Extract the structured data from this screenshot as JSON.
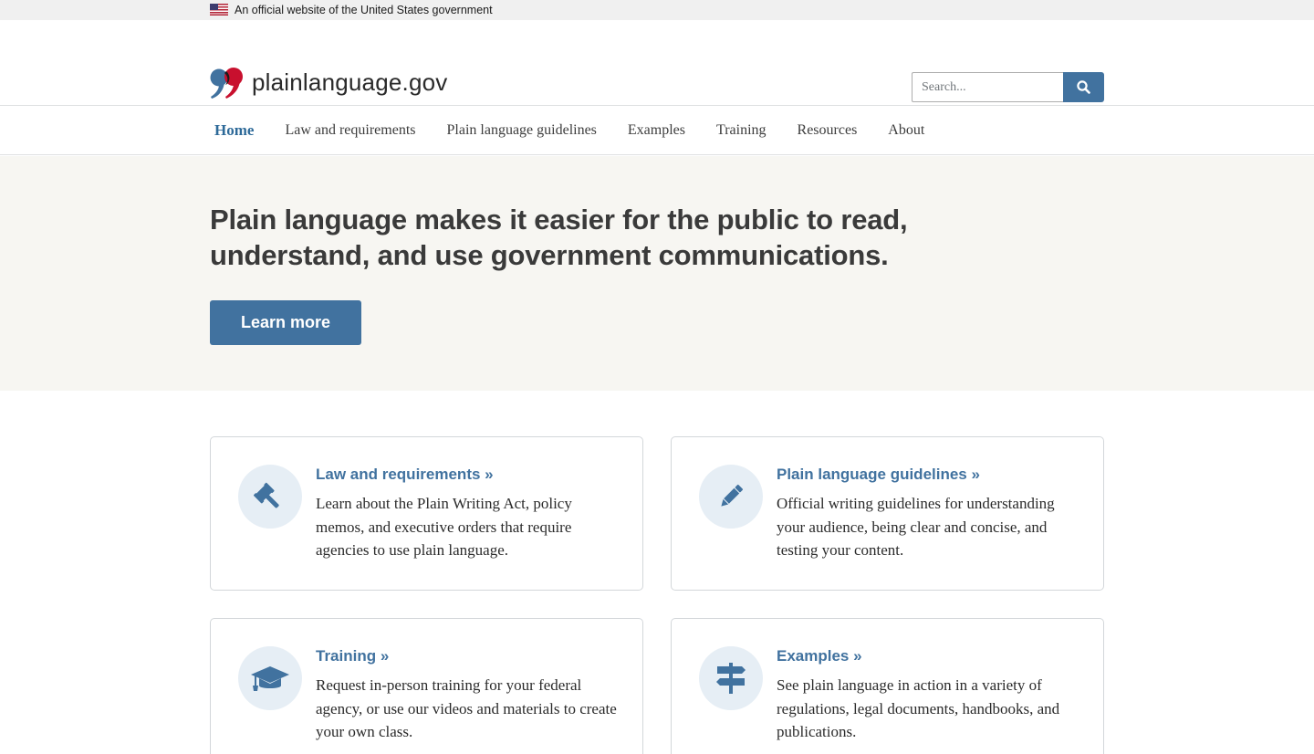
{
  "gov_banner": {
    "text": "An official website of the United States government",
    "flag_icon": "us-flag-icon"
  },
  "header": {
    "logo_text": "plainlanguage.gov",
    "logo_icon": "quotation-mark-logo-icon",
    "search": {
      "placeholder": "Search...",
      "button_icon": "search-icon"
    }
  },
  "nav": {
    "items": [
      {
        "label": "Home",
        "active": true
      },
      {
        "label": "Law and requirements"
      },
      {
        "label": "Plain language guidelines"
      },
      {
        "label": "Examples"
      },
      {
        "label": "Training"
      },
      {
        "label": "Resources"
      },
      {
        "label": "About"
      }
    ]
  },
  "hero": {
    "headline": "Plain language makes it easier for the public to read, understand, and use government communications.",
    "button_label": "Learn more"
  },
  "cards": [
    {
      "title": "Law and requirements »",
      "text": "Learn about the Plain Writing Act, policy memos, and executive orders that require agencies to use plain language.",
      "icon": "gavel-icon"
    },
    {
      "title": "Plain language guidelines »",
      "text": "Official writing guidelines for understanding your audience, being clear and concise, and testing your content.",
      "icon": "pencil-icon"
    },
    {
      "title": "Training »",
      "text": "Request in-person training for your federal agency, or use our videos and materials to create your own class.",
      "icon": "graduation-cap-icon"
    },
    {
      "title": "Examples »",
      "text": "See plain language in action in a variety of regulations, legal documents, handbooks, and publications.",
      "icon": "signpost-icon"
    }
  ],
  "colors": {
    "primary": "#41729f",
    "nav_active": "#2e6a99",
    "hero_bg": "#f7f6f2",
    "icon_circle_bg": "#e6eef5",
    "logo_blue": "#41729f",
    "logo_red": "#c8102e"
  }
}
